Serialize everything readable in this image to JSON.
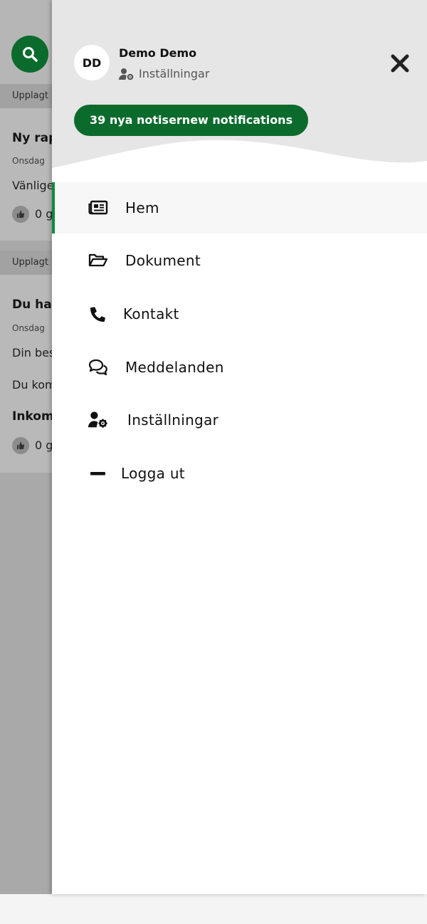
{
  "background_feed": {
    "posts": [
      {
        "posted_label": "Upplagt",
        "title": "Ny rap",
        "date": "Onsdag",
        "text": "Vänlige",
        "likes": "0 g"
      },
      {
        "posted_label": "Upplagt",
        "title": "Du har",
        "date": "Onsdag",
        "text_lines": [
          "Din bes",
          "Du kom"
        ],
        "subheading": "Inkom",
        "likes": "0 g"
      }
    ]
  },
  "drawer": {
    "avatar_initials": "DD",
    "user_name": "Demo Demo",
    "settings_link": "Inställningar",
    "notifications_button": "39 nya notisernew notifications",
    "menu": [
      {
        "label": "Hem",
        "icon": "newspaper-icon",
        "active": true
      },
      {
        "label": "Dokument",
        "icon": "folder-open-icon",
        "active": false
      },
      {
        "label": "Kontakt",
        "icon": "phone-icon",
        "active": false
      },
      {
        "label": "Meddelanden",
        "icon": "comments-icon",
        "active": false
      },
      {
        "label": "Inställningar",
        "icon": "user-cog-icon",
        "active": false
      },
      {
        "label": "Logga ut",
        "icon": "minus-icon",
        "active": false
      }
    ]
  },
  "colors": {
    "brand_green": "#0b6b2c",
    "active_indicator": "#0e8a3a",
    "overlay": "#a9a9a9"
  }
}
